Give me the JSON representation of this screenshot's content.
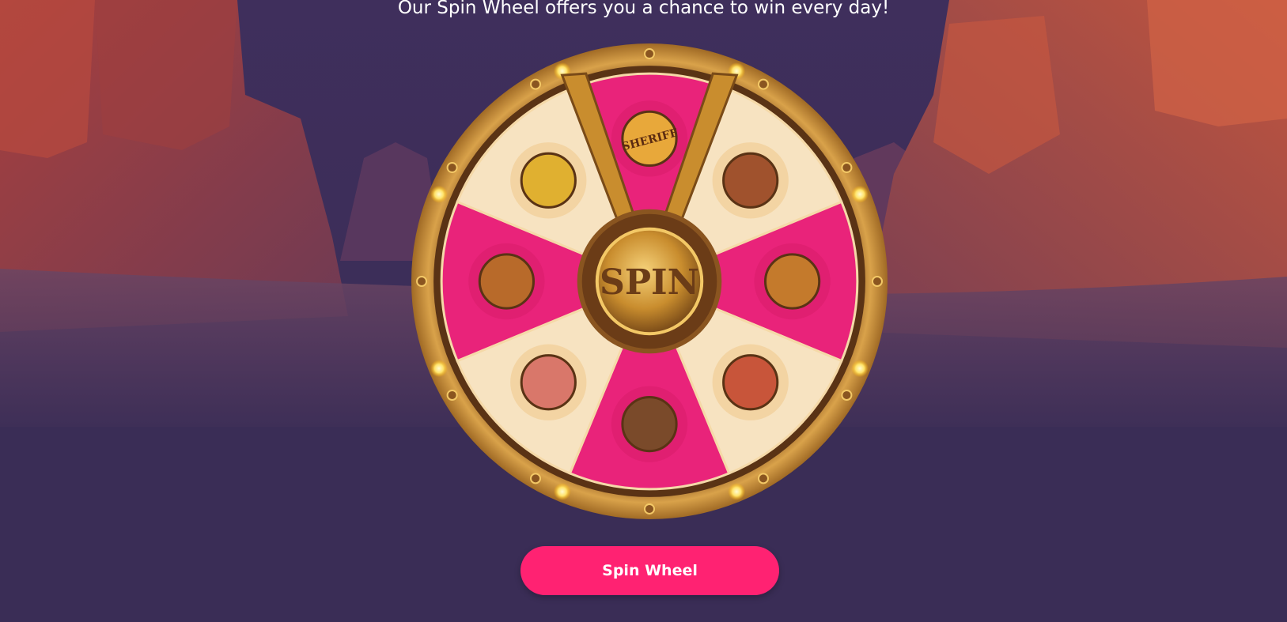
{
  "header": {
    "subtitle": "Our Spin Wheel offers you a chance to win every day!"
  },
  "wheel": {
    "center_label": "SPIN",
    "segments": [
      {
        "name": "sheriff-badge",
        "badge_text": "SHERIFF",
        "color": "#e9237a"
      },
      {
        "name": "cowboy",
        "color": "#f7e3c1"
      },
      {
        "name": "pot-of-gold",
        "color": "#e9237a"
      },
      {
        "name": "dynamite",
        "color": "#f7e3c1"
      },
      {
        "name": "cowboy-hat",
        "color": "#e9237a"
      },
      {
        "name": "safe",
        "color": "#f7e3c1"
      },
      {
        "name": "cash-register",
        "color": "#e9237a"
      },
      {
        "name": "horseshoe",
        "color": "#f7e3c1"
      }
    ]
  },
  "actions": {
    "spin_label": "Spin Wheel"
  },
  "colors": {
    "background": "#3a2d56",
    "button": "#ff2272",
    "rim": "#c98d2e",
    "pink": "#e9237a",
    "cream": "#f7e3c1"
  }
}
